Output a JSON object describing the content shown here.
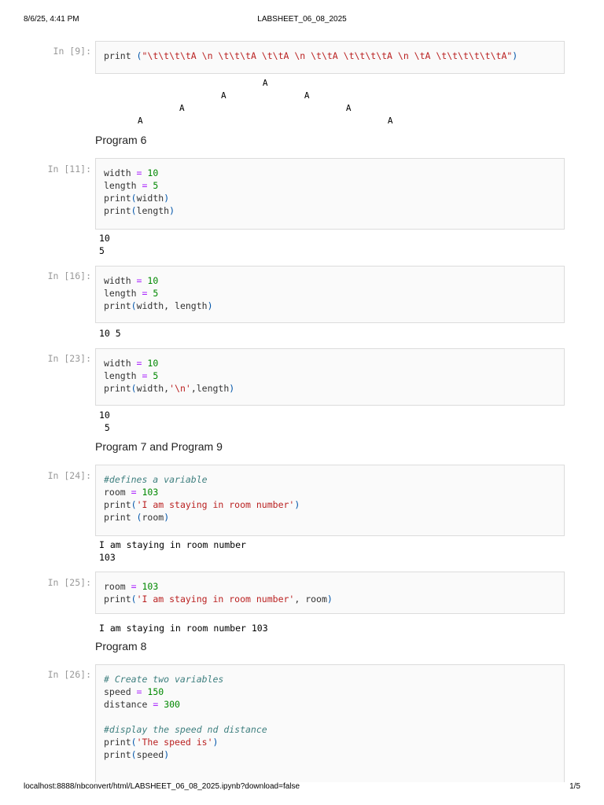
{
  "header": {
    "datetime": "8/6/25, 4:41 PM",
    "title": "LABSHEET_06_08_2025"
  },
  "footer": {
    "url": "localhost:8888/nbconvert/html/LABSHEET_06_08_2025.ipynb?download=false",
    "page": "1/5"
  },
  "colors": {
    "number": "#008800",
    "operator": "#AA22FF",
    "string": "#BA2121",
    "paren": "#0055AA",
    "comment": "#408080"
  },
  "cells": [
    {
      "prompt": "In [9]:",
      "lines": [
        [
          [
            "print ",
            "n"
          ],
          [
            "(",
            "p"
          ],
          [
            "\"\\t\\t\\t\\tA \\n \\t\\t\\tA \\t\\tA \\n \\t\\tA \\t\\t\\t\\tA \\n \\tA \\t\\t\\t\\t\\t\\tA\"",
            "s"
          ],
          [
            ")",
            "p"
          ]
        ]
      ],
      "output": "\t\t\t\tA\n \t\t\tA \t\tA\n \t\tA \t\t\t\tA\n \tA \t\t\t\t\t\tA"
    },
    {
      "prompt": "In [11]:",
      "lines": [
        [
          [
            "width ",
            "n"
          ],
          [
            "=",
            "op"
          ],
          [
            " ",
            "n"
          ],
          [
            "10",
            "num"
          ]
        ],
        [
          [
            "length ",
            "n"
          ],
          [
            "=",
            "op"
          ],
          [
            " ",
            "n"
          ],
          [
            "5",
            "num"
          ]
        ],
        [
          [
            "print",
            "n"
          ],
          [
            "(",
            "p"
          ],
          [
            "width",
            "n"
          ],
          [
            ")",
            "p"
          ]
        ],
        [
          [
            "print",
            "n"
          ],
          [
            "(",
            "p"
          ],
          [
            "length",
            "n"
          ],
          [
            ")",
            "p"
          ]
        ]
      ],
      "output": "10\n5"
    },
    {
      "prompt": "In [16]:",
      "lines": [
        [
          [
            "width ",
            "n"
          ],
          [
            "=",
            "op"
          ],
          [
            " ",
            "n"
          ],
          [
            "10",
            "num"
          ]
        ],
        [
          [
            "length ",
            "n"
          ],
          [
            "=",
            "op"
          ],
          [
            " ",
            "n"
          ],
          [
            "5",
            "num"
          ]
        ],
        [
          [
            "print",
            "n"
          ],
          [
            "(",
            "p"
          ],
          [
            "width, length",
            "n"
          ],
          [
            ")",
            "p"
          ]
        ]
      ],
      "output": "10 5"
    },
    {
      "prompt": "In [23]:",
      "lines": [
        [
          [
            "width ",
            "n"
          ],
          [
            "=",
            "op"
          ],
          [
            " ",
            "n"
          ],
          [
            "10",
            "num"
          ]
        ],
        [
          [
            "length ",
            "n"
          ],
          [
            "=",
            "op"
          ],
          [
            " ",
            "n"
          ],
          [
            "5",
            "num"
          ]
        ],
        [
          [
            "print",
            "n"
          ],
          [
            "(",
            "p"
          ],
          [
            "width,",
            "n"
          ],
          [
            "'\\n'",
            "s"
          ],
          [
            ",length",
            "n"
          ],
          [
            ")",
            "p"
          ]
        ]
      ],
      "output": "10\n 5"
    },
    {
      "prompt": "In [24]:",
      "lines": [
        [
          [
            "#defines a variable",
            "c"
          ]
        ],
        [
          [
            "room ",
            "n"
          ],
          [
            "=",
            "op"
          ],
          [
            " ",
            "n"
          ],
          [
            "103",
            "num"
          ]
        ],
        [
          [
            "print",
            "n"
          ],
          [
            "(",
            "p"
          ],
          [
            "'I am staying in room number'",
            "s"
          ],
          [
            ")",
            "p"
          ]
        ],
        [
          [
            "print ",
            "n"
          ],
          [
            "(",
            "p"
          ],
          [
            "room",
            "n"
          ],
          [
            ")",
            "p"
          ]
        ]
      ],
      "output": "I am staying in room number\n103"
    },
    {
      "prompt": "In [25]:",
      "lines": [
        [
          [
            "room ",
            "n"
          ],
          [
            "=",
            "op"
          ],
          [
            " ",
            "n"
          ],
          [
            "103",
            "num"
          ]
        ],
        [
          [
            "print",
            "n"
          ],
          [
            "(",
            "p"
          ],
          [
            "'I am staying in room number'",
            "s"
          ],
          [
            ", room",
            "n"
          ],
          [
            ")",
            "p"
          ]
        ]
      ],
      "output": "I am staying in room number 103"
    },
    {
      "prompt": "In [26]:",
      "lines": [
        [
          [
            "# Create two variables",
            "c"
          ]
        ],
        [
          [
            "speed ",
            "n"
          ],
          [
            "=",
            "op"
          ],
          [
            " ",
            "n"
          ],
          [
            "150",
            "num"
          ]
        ],
        [
          [
            "distance ",
            "n"
          ],
          [
            "=",
            "op"
          ],
          [
            " ",
            "n"
          ],
          [
            "300",
            "num"
          ]
        ],
        [
          [
            "",
            ""
          ]
        ],
        [
          [
            "#display the speed nd distance",
            "c"
          ]
        ],
        [
          [
            "print",
            "n"
          ],
          [
            "(",
            "p"
          ],
          [
            "'The speed is'",
            "s"
          ],
          [
            ")",
            "p"
          ]
        ],
        [
          [
            "print",
            "n"
          ],
          [
            "(",
            "p"
          ],
          [
            "speed",
            "n"
          ],
          [
            ")",
            "p"
          ]
        ]
      ],
      "output": null
    }
  ],
  "headings": [
    "Program 6",
    "Program 7 and Program 9",
    "Program 8"
  ]
}
